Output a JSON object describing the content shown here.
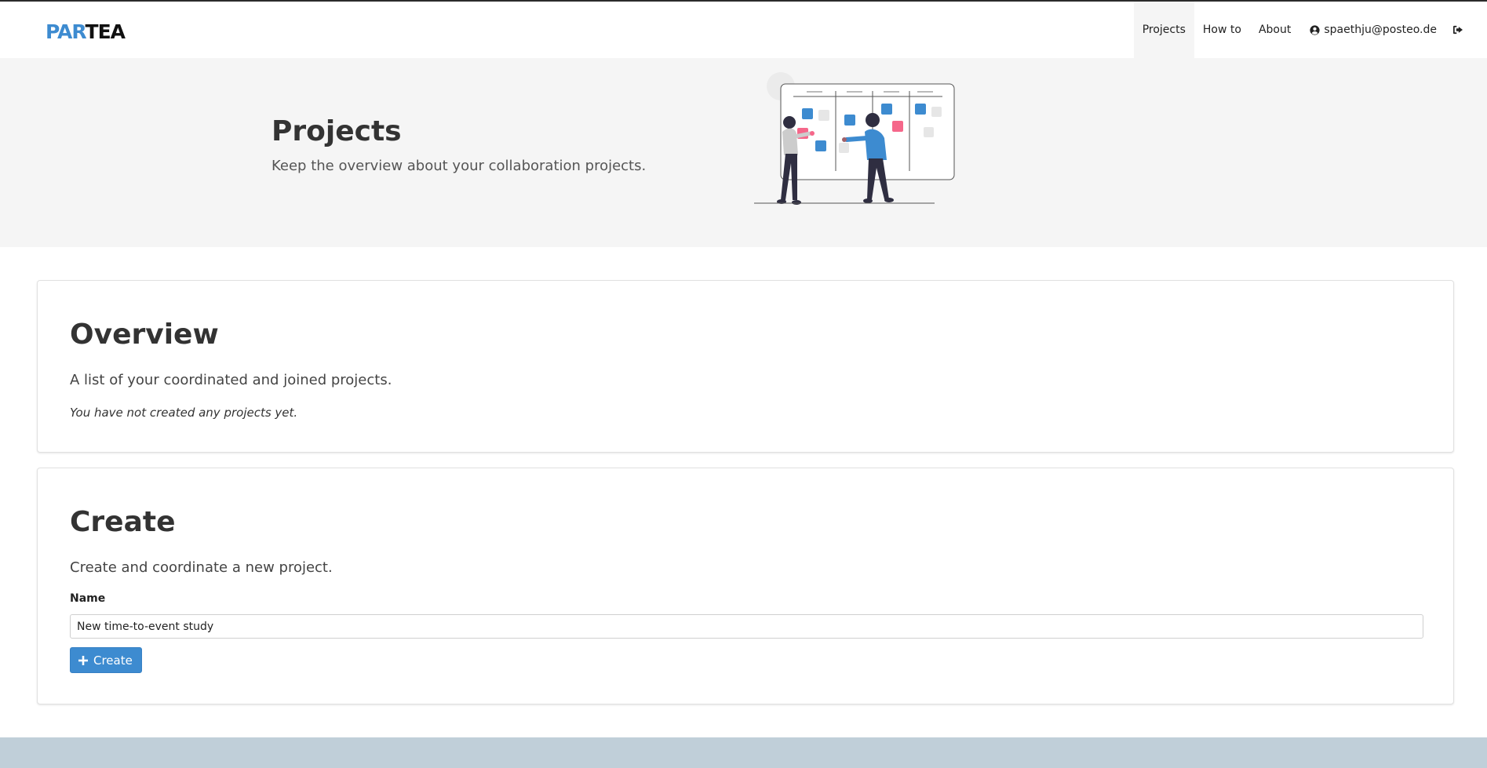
{
  "brand": {
    "part1": "PAR",
    "part2": "TEA"
  },
  "nav": {
    "items": [
      {
        "label": "Projects",
        "active": true
      },
      {
        "label": "How to",
        "active": false
      },
      {
        "label": "About",
        "active": false
      }
    ],
    "user_email": "spaethju@posteo.de",
    "user_icon": "user-circle-icon",
    "logout_icon": "sign-out-icon"
  },
  "hero": {
    "title": "Projects",
    "subtitle": "Keep the overview about your collaboration projects."
  },
  "overview": {
    "title": "Overview",
    "lead": "A list of your coordinated and joined projects.",
    "empty_note": "You have not created any projects yet."
  },
  "create": {
    "title": "Create",
    "lead": "Create and coordinate a new project.",
    "name_label": "Name",
    "name_value": "New time-to-event study",
    "button_label": "Create",
    "button_icon": "plus-icon"
  },
  "colors": {
    "accent": "#3d8bd0",
    "hero_bg": "#f5f5f5",
    "footer_bg": "#c0cfd9",
    "sticky_pink": "#f5678a"
  }
}
